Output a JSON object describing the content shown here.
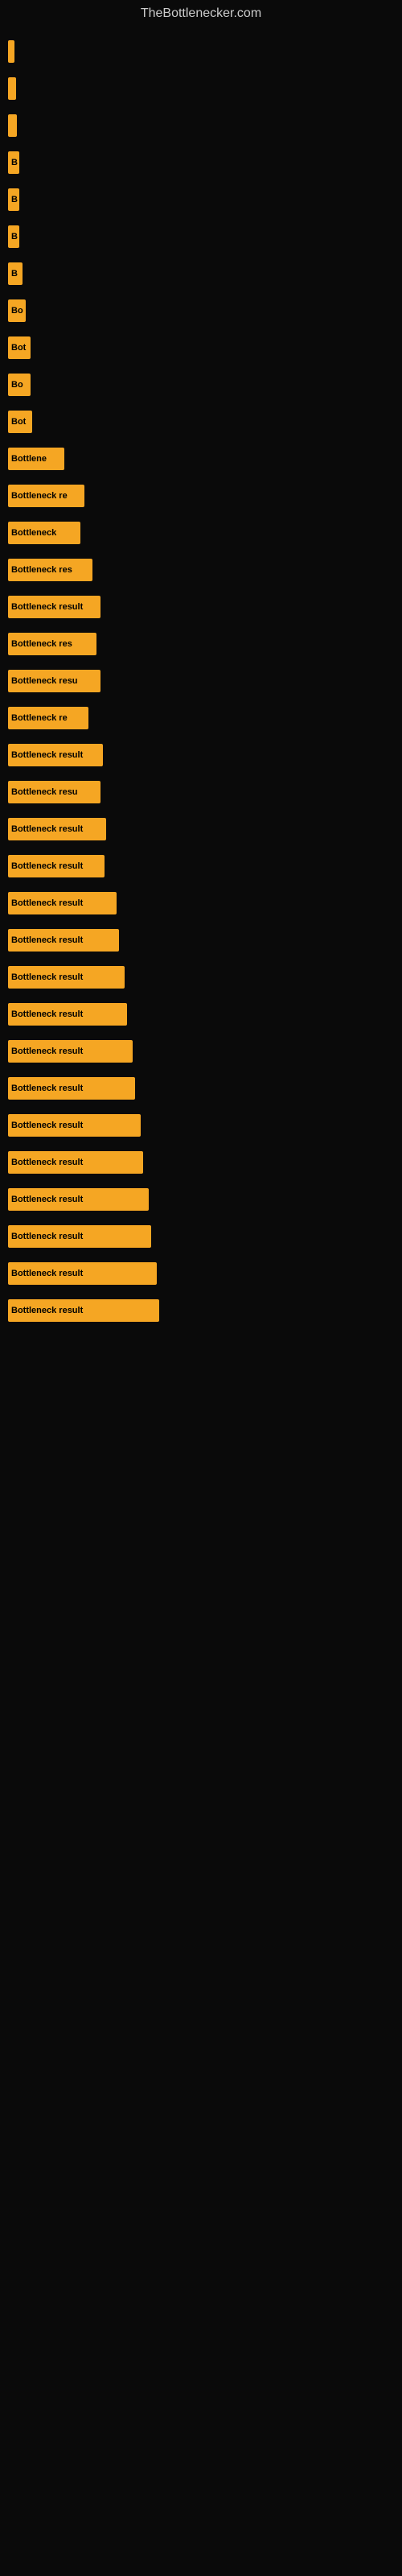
{
  "site": {
    "title": "TheBottlenecker.com"
  },
  "bars": [
    {
      "width": 8,
      "label": ""
    },
    {
      "width": 10,
      "label": ""
    },
    {
      "width": 11,
      "label": ""
    },
    {
      "width": 14,
      "label": "B"
    },
    {
      "width": 14,
      "label": "B"
    },
    {
      "width": 14,
      "label": "B"
    },
    {
      "width": 18,
      "label": "B"
    },
    {
      "width": 22,
      "label": "Bo"
    },
    {
      "width": 28,
      "label": "Bot"
    },
    {
      "width": 28,
      "label": "Bo"
    },
    {
      "width": 30,
      "label": "Bot"
    },
    {
      "width": 70,
      "label": "Bottlene"
    },
    {
      "width": 95,
      "label": "Bottleneck re"
    },
    {
      "width": 90,
      "label": "Bottleneck"
    },
    {
      "width": 105,
      "label": "Bottleneck res"
    },
    {
      "width": 115,
      "label": "Bottleneck result"
    },
    {
      "width": 110,
      "label": "Bottleneck res"
    },
    {
      "width": 115,
      "label": "Bottleneck resu"
    },
    {
      "width": 100,
      "label": "Bottleneck re"
    },
    {
      "width": 118,
      "label": "Bottleneck result"
    },
    {
      "width": 115,
      "label": "Bottleneck resu"
    },
    {
      "width": 122,
      "label": "Bottleneck result"
    },
    {
      "width": 120,
      "label": "Bottleneck result"
    },
    {
      "width": 135,
      "label": "Bottleneck result"
    },
    {
      "width": 138,
      "label": "Bottleneck result"
    },
    {
      "width": 145,
      "label": "Bottleneck result"
    },
    {
      "width": 148,
      "label": "Bottleneck result"
    },
    {
      "width": 155,
      "label": "Bottleneck result"
    },
    {
      "width": 158,
      "label": "Bottleneck result"
    },
    {
      "width": 165,
      "label": "Bottleneck result"
    },
    {
      "width": 168,
      "label": "Bottleneck result"
    },
    {
      "width": 175,
      "label": "Bottleneck result"
    },
    {
      "width": 178,
      "label": "Bottleneck result"
    },
    {
      "width": 185,
      "label": "Bottleneck result"
    },
    {
      "width": 188,
      "label": "Bottleneck result"
    }
  ]
}
